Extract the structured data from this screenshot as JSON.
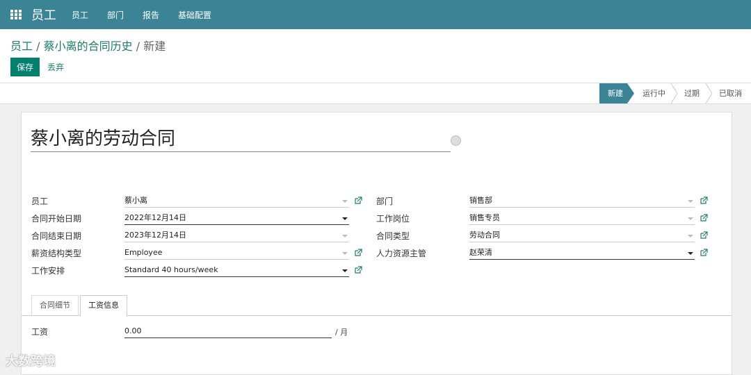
{
  "navbar": {
    "brand": "员工",
    "menu": [
      "员工",
      "部门",
      "报告",
      "基础配置"
    ]
  },
  "breadcrumb": {
    "items": [
      "员工",
      "蔡小离的合同历史"
    ],
    "current": "新建",
    "separator": "/"
  },
  "actions": {
    "save_label": "保存",
    "discard_label": "丢弃"
  },
  "statusbar": {
    "stages": [
      "新建",
      "运行中",
      "过期",
      "已取消"
    ],
    "current_stage": "新建"
  },
  "form": {
    "title": "蔡小离的劳动合同",
    "left": {
      "employee": {
        "label": "员工",
        "value": "蔡小离"
      },
      "start_date": {
        "label": "合同开始日期",
        "value": "2022年12月14日"
      },
      "end_date": {
        "label": "合同结束日期",
        "value": "2023年12月14日"
      },
      "salary_structure": {
        "label": "薪资结构类型",
        "value": "Employee"
      },
      "schedule": {
        "label": "工作安排",
        "value": "Standard 40 hours/week"
      }
    },
    "right": {
      "department": {
        "label": "部门",
        "value": "销售部"
      },
      "job_position": {
        "label": "工作岗位",
        "value": "销售专员"
      },
      "contract_type": {
        "label": "合同类型",
        "value": "劳动合同"
      },
      "hr_manager": {
        "label": "人力资源主管",
        "value": "赵荣清"
      }
    },
    "tabs": [
      "合同细节",
      "工资信息"
    ],
    "active_tab": "工资信息",
    "wage": {
      "label": "工资",
      "value": "0.00",
      "suffix": "/ 月"
    }
  },
  "watermark": "大数跨境",
  "colors": {
    "navbar": "#3b8496",
    "primary_button": "#00806d",
    "link": "#1f7a6a"
  }
}
